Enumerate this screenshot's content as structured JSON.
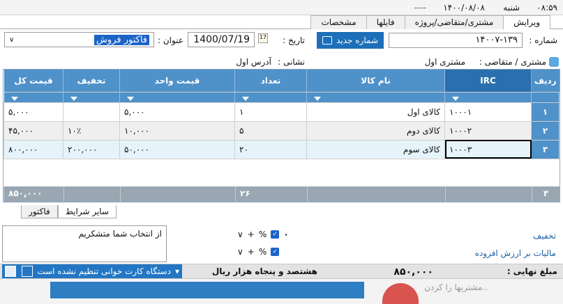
{
  "topbar": {
    "clock": "۰۸:۵۹",
    "day": "شنبه",
    "date": "۱۴۰۰/۰۸/۰۸",
    "dash": "----"
  },
  "tabs": [
    {
      "label": "ویرایش"
    },
    {
      "label": "مشتری/متقاضی/پروژه"
    },
    {
      "label": "فایلها"
    },
    {
      "label": "مشخصات"
    }
  ],
  "form": {
    "number_label": "شماره :",
    "number_value": "۱۴۰۰۷-۱۳۹",
    "new_number_button": "شماره جدید",
    "date_label": "تاریخ :",
    "date_value": "1400/07/19",
    "title_label": "عنوان :",
    "title_value": "فاکتور فروش",
    "customer_label": "مشتری / متقاضی :",
    "customer_value": "مشتری اول",
    "address_label": "نشانی :",
    "address_value": "آدرس اول"
  },
  "grid": {
    "columns": [
      "ردیف",
      "IRC",
      "نام کالا",
      "تعداد",
      "قیمت واحد",
      "تخفیف",
      "قیمت کل"
    ],
    "rows": [
      {
        "row": "۱",
        "irc": "۱۰۰۰۱",
        "name": "کالای اول",
        "qty": "۱",
        "unit_price": "۵,۰۰۰",
        "discount": "",
        "total": "۵,۰۰۰"
      },
      {
        "row": "۲",
        "irc": "۱۰۰۰۲",
        "name": "کالای دوم",
        "qty": "۵",
        "unit_price": "۱۰,۰۰۰",
        "discount": "۱۰٪",
        "total": "۴۵,۰۰۰"
      },
      {
        "row": "۳",
        "irc": "۱۰۰۰۳",
        "name": "کالای سوم",
        "qty": "۲۰",
        "unit_price": "۵۰,۰۰۰",
        "discount": "۲۰۰,۰۰۰",
        "total": "۸۰۰,۰۰۰"
      }
    ],
    "footer": {
      "row": "۳",
      "qty_total": "۲۶",
      "total": "۸۵۰,۰۰۰"
    }
  },
  "subtabs": [
    {
      "label": "سایر شرایط"
    },
    {
      "label": "فاکتور"
    }
  ],
  "notes": "از انتخاب شما متشکریم",
  "adjustments": {
    "discount_label": "تخفیف",
    "vat_label": "مالیات بر ارزش افزوده",
    "discount_value": "۰",
    "percent": "%",
    "plus": "+",
    "chevron": "∨"
  },
  "summary": {
    "final_label": "مبلغ نهایی :",
    "final_value": "۸۵۰,۰۰۰",
    "words": "هشتصد و پنجاه  هزار  ریال"
  },
  "card_reader": {
    "status": "دستگاه کارت خوانی تنظیم نشده است"
  },
  "footer_strip": {
    "hint": "..مشتریها را کردن"
  }
}
